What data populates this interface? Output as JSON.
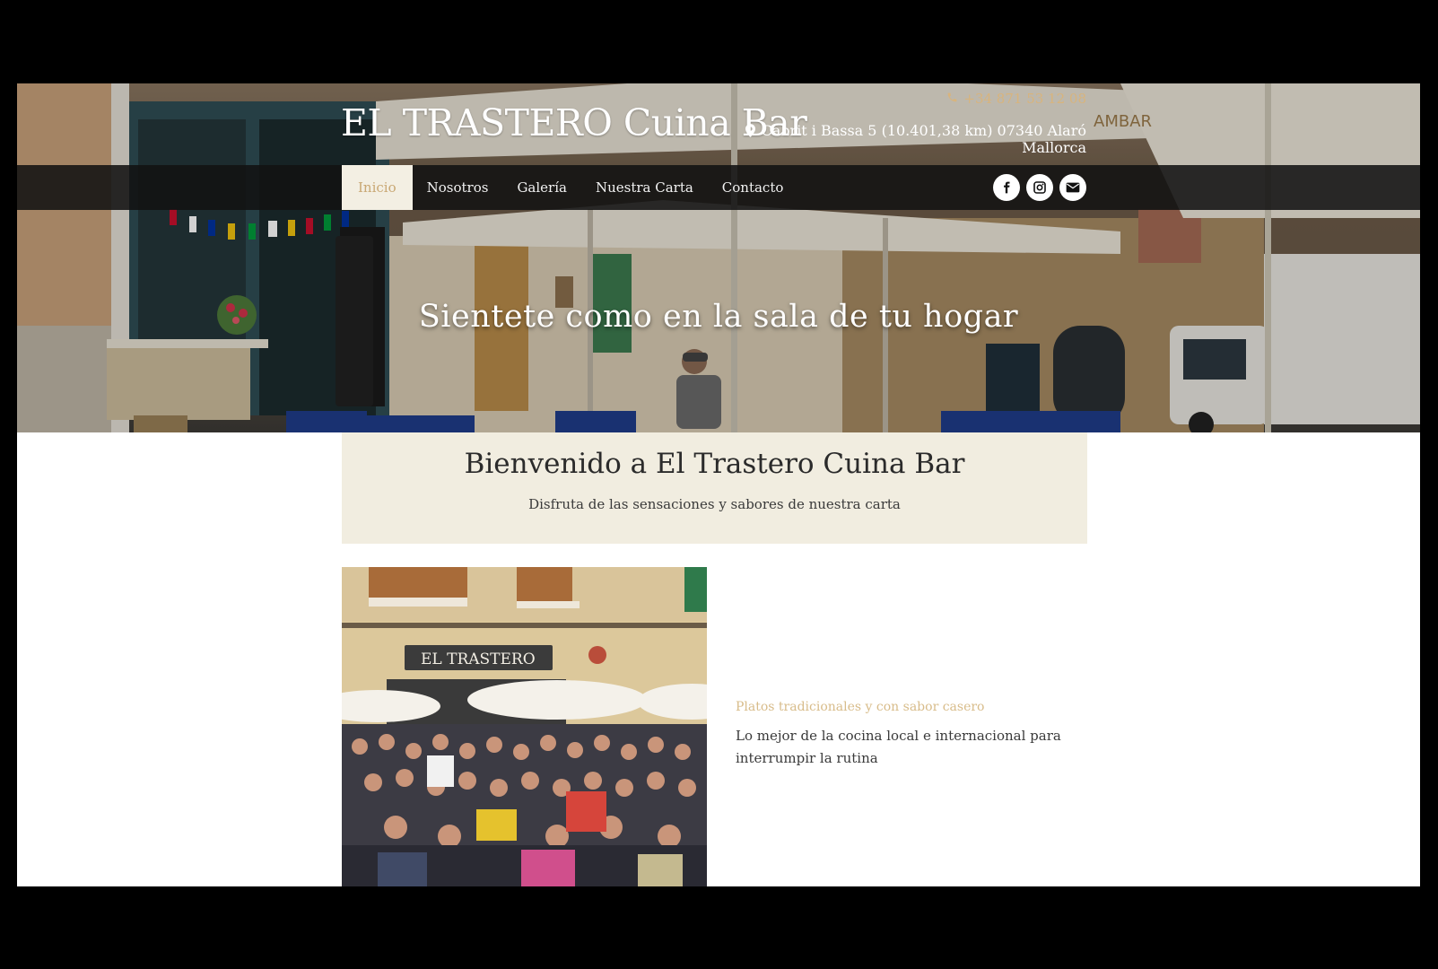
{
  "header": {
    "brand": "EL TRASTERO Cuina Bar",
    "phone": "+34 871 53 12 08",
    "address_line1": "Cabrit i Bassa 5 (10.401,38 km) 07340 Alaró",
    "address_line2": "Mallorca"
  },
  "nav": {
    "items": [
      "Inicio",
      "Nosotros",
      "Galería",
      "Nuestra Carta",
      "Contacto"
    ],
    "active_index": 0
  },
  "social": [
    "facebook-icon",
    "instagram-icon",
    "envelope-icon"
  ],
  "hero": {
    "tagline": "Sientete como en la sala de tu hogar",
    "sign_text": "EL TRASTERO",
    "umbrella_text": "AMBAR"
  },
  "welcome": {
    "title": "Bienvenido a El Trastero Cuina Bar",
    "subtitle": "Disfruta de las sensaciones y sabores de nuestra carta"
  },
  "feature": {
    "heading": "Platos tradicionales y con sabor casero",
    "text": "Lo mejor de la cocina local e internacional para interrumpir la rutina"
  },
  "colors": {
    "accent": "#c9a874",
    "nav_bg": "#121212",
    "welcome_bg": "#f1ede0"
  }
}
